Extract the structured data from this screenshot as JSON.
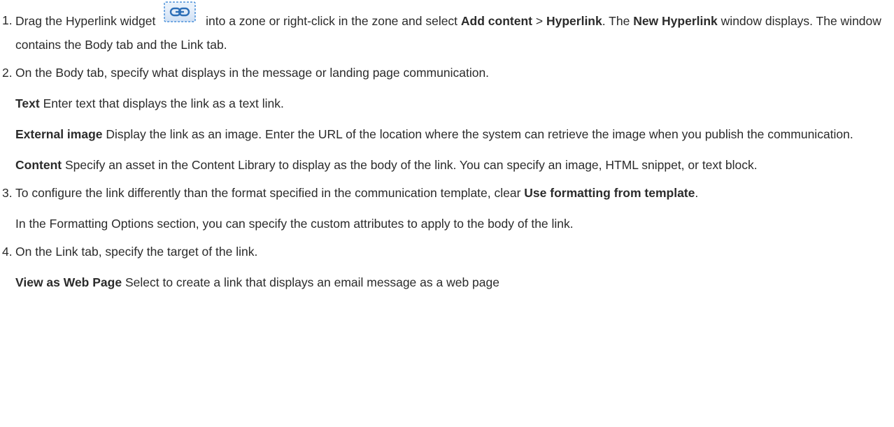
{
  "steps": [
    {
      "num": "1.",
      "lead": "Drag the Hyperlink widget",
      "icon": "hyperlink-widget-icon",
      "after_icon": "into a zone or right-click in the zone and select",
      "menu_path_1": "Add content",
      "menu_sep": ">",
      "menu_path_2": "Hyperlink",
      "tail_1": ". The",
      "window_name": "New Hyperlink",
      "tail_2": "window displays. The window contains the Body tab and the Link tab."
    },
    {
      "num": "2.",
      "text": "On the Body tab, specify what displays in the message or landing page communication.",
      "options": [
        {
          "term": "Text",
          "desc": "Enter text that displays the link as a text link."
        },
        {
          "term": "External image",
          "desc": "Display the link as an image. Enter the URL of the location where the system can retrieve the image when you publish the communication."
        },
        {
          "term": "Content",
          "desc": "Specify an asset in the Content Library to display as the body of the link. You can specify an image, HTML snippet, or text block."
        }
      ]
    },
    {
      "num": "3.",
      "lead": "To configure the link differently than the format specified in the communication template, clear",
      "option": "Use formatting from template",
      "tail": ".",
      "note": "In the Formatting Options section, you can specify the custom attributes to apply to the body of the link."
    },
    {
      "num": "4.",
      "text": "On the Link tab, specify the target of the link.",
      "option_term": "View as Web Page",
      "option_desc": "Select to create a link that displays an email message as a web page"
    }
  ],
  "colors": {
    "text": "#2b2b2b",
    "icon_border": "#4a90d9",
    "icon_fill": "#dbe9f8"
  }
}
